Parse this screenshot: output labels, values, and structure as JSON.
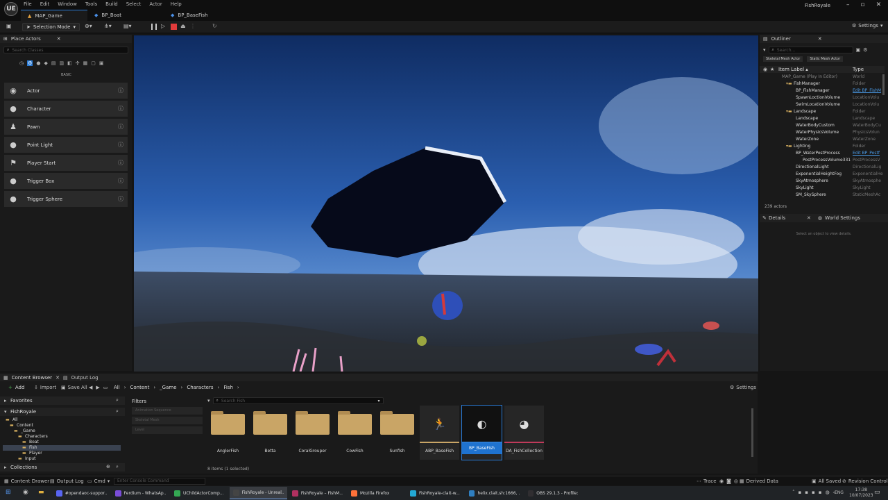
{
  "app": {
    "title": "FishRoyale",
    "logo": "UE"
  },
  "menu": [
    "File",
    "Edit",
    "Window",
    "Tools",
    "Build",
    "Select",
    "Actor",
    "Help"
  ],
  "doc_tabs": [
    "MAP_Game",
    "BP_Boat",
    "BP_BaseFish"
  ],
  "window_controls": [
    "–",
    "▫",
    "✕"
  ],
  "toolbar": {
    "mode": "Selection Mode",
    "settings": "Settings"
  },
  "place_actors": {
    "tab": "Place Actors",
    "search_placeholder": "Search Classes",
    "category": "BASIC",
    "items": [
      {
        "label": "Actor",
        "icon": "◉"
      },
      {
        "label": "Character",
        "icon": "●"
      },
      {
        "label": "Pawn",
        "icon": "♟"
      },
      {
        "label": "Point Light",
        "icon": "●"
      },
      {
        "label": "Player Start",
        "icon": "⚑"
      },
      {
        "label": "Trigger Box",
        "icon": "●"
      },
      {
        "label": "Trigger Sphere",
        "icon": "●"
      }
    ]
  },
  "outliner": {
    "tab": "Outliner",
    "search_placeholder": "Search...",
    "filters": [
      "Skeletal Mesh Actor",
      "Static Mesh Actor"
    ],
    "col_label": "Item Label ▴",
    "col_type": "Type",
    "rows": [
      {
        "name": "MAP_Game (Play In Editor)",
        "type": "World",
        "indent": 0,
        "dim": true
      },
      {
        "name": "FishManager",
        "type": "Folder",
        "indent": 1,
        "folder": true
      },
      {
        "name": "BP_FishManager",
        "type": "Edit BP_FishM",
        "indent": 2,
        "link": true
      },
      {
        "name": "SpawnLoctionVolume",
        "type": "LocationVolu",
        "indent": 2
      },
      {
        "name": "SwimLocationVolume",
        "type": "LocationVolu",
        "indent": 2
      },
      {
        "name": "Landscape",
        "type": "Folder",
        "indent": 1,
        "folder": true
      },
      {
        "name": "Landscape",
        "type": "Landscape",
        "indent": 2
      },
      {
        "name": "WaterBodyCustom",
        "type": "WaterBodyCu",
        "indent": 2
      },
      {
        "name": "WaterPhysicsVolume",
        "type": "PhysicsVolun",
        "indent": 2
      },
      {
        "name": "WaterZone",
        "type": "WaterZone",
        "indent": 2
      },
      {
        "name": "Lighting",
        "type": "Folder",
        "indent": 1,
        "folder": true
      },
      {
        "name": "BP_WaterPostProcess",
        "type": "Edit BP_Postf",
        "indent": 2,
        "link": true
      },
      {
        "name": "PostProcessVolume331",
        "type": "PostProcessV",
        "indent": 3
      },
      {
        "name": "DirectionalLight",
        "type": "DirectionalLig",
        "indent": 2
      },
      {
        "name": "ExponentialHeightFog",
        "type": "ExponentialHe",
        "indent": 2
      },
      {
        "name": "SkyAtmosphere",
        "type": "SkyAtmosphe",
        "indent": 2
      },
      {
        "name": "SkyLight",
        "type": "SkyLight",
        "indent": 2
      },
      {
        "name": "SM_SkySphere",
        "type": "StaticMeshAc",
        "indent": 2
      }
    ],
    "count": "239 actors"
  },
  "details": {
    "tab": "Details",
    "tab2": "World Settings",
    "empty": "Select an object to view details."
  },
  "content_browser": {
    "tab": "Content Browser",
    "tab2": "Output Log",
    "add": "Add",
    "import": "Import",
    "save_all": "Save All",
    "breadcrumb": [
      "All",
      "Content",
      "_Game",
      "Characters",
      "Fish"
    ],
    "settings": "Settings",
    "favorites": "Favorites",
    "root": "FishRoyale",
    "tree": [
      "All",
      "Content",
      "_Game",
      "Characters",
      "Boat",
      "Fish",
      "Player",
      "Input"
    ],
    "filters_title": "Filters",
    "filters": [
      "Animation Sequence",
      "Skeletal Mesh",
      "Level"
    ],
    "search_placeholder": "Search Fish",
    "assets": [
      {
        "label": "AnglerFish",
        "kind": "folder"
      },
      {
        "label": "Betta",
        "kind": "folder"
      },
      {
        "label": "CoralGrouper",
        "kind": "folder"
      },
      {
        "label": "CowFish",
        "kind": "folder"
      },
      {
        "label": "Sunfish",
        "kind": "folder"
      },
      {
        "label": "ABP_BaseFish",
        "kind": "anim"
      },
      {
        "label": "BP_BaseFish",
        "kind": "bp",
        "selected": true
      },
      {
        "label": "DA_FishCollection",
        "kind": "data"
      }
    ],
    "status": "8 items (1 selected)",
    "collections": "Collections"
  },
  "bottom": {
    "drawer": "Content Drawer",
    "output": "Output Log",
    "cmd": "Cmd",
    "console_placeholder": "Enter Console Command",
    "trace": "Trace",
    "derived": "Derived Data",
    "saved": "All Saved",
    "revision": "Revision Control"
  },
  "taskbar": {
    "items": [
      {
        "label": "#opendaoc-suppor...",
        "color": "#5865f2"
      },
      {
        "label": "Ferdium - WhatsAp...",
        "color": "#7a4dd8"
      },
      {
        "label": "UChildActorComp...",
        "color": "#34a853"
      },
      {
        "label": "FishRoyale - Unreal...",
        "color": "#444444"
      },
      {
        "label": "FishRoyale – FishM...",
        "color": "#b03060"
      },
      {
        "label": "Mozilla Firefox",
        "color": "#ff7139"
      },
      {
        "label": "FishRoyale-clait-w...",
        "color": "#23a9d5"
      },
      {
        "label": "helix.clait.sh:1666, ...",
        "color": "#2f7fc1"
      },
      {
        "label": "OBS 29.1.3 - Profile:...",
        "color": "#302e31"
      }
    ],
    "lang": "ENG",
    "time": "17:38",
    "date": "10/07/2023"
  }
}
